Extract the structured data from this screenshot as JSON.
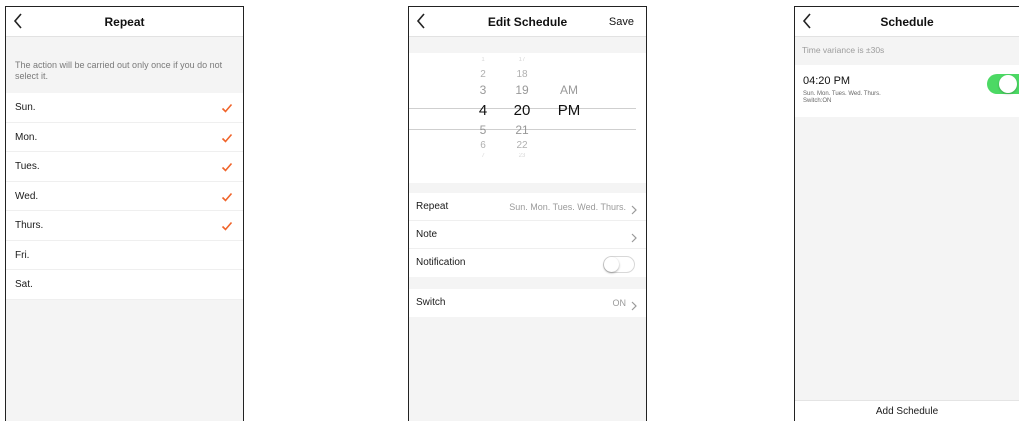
{
  "colors": {
    "accent_check": "#f0642a",
    "toggle_on": "#4cd964"
  },
  "repeat_screen": {
    "title": "Repeat",
    "hint": "The action will be carried out only once if you do not select it.",
    "days": [
      {
        "label": "Sun.",
        "checked": true
      },
      {
        "label": "Mon.",
        "checked": true
      },
      {
        "label": "Tues.",
        "checked": true
      },
      {
        "label": "Wed.",
        "checked": true
      },
      {
        "label": "Thurs.",
        "checked": true
      },
      {
        "label": "Fri.",
        "checked": false
      },
      {
        "label": "Sat.",
        "checked": false
      }
    ],
    "icons": {
      "back": "chevron-left-icon",
      "check": "checkmark-icon"
    }
  },
  "edit_screen": {
    "title": "Edit Schedule",
    "save_label": "Save",
    "picker": {
      "hours": [
        "1",
        "2",
        "3",
        "4",
        "5",
        "6",
        "7"
      ],
      "minutes": [
        "17",
        "18",
        "19",
        "20",
        "21",
        "22",
        "23"
      ],
      "periods": [
        "AM",
        "PM"
      ],
      "selected_hour": "4",
      "selected_minute": "20",
      "selected_period": "PM"
    },
    "repeat": {
      "label": "Repeat",
      "value": "Sun. Mon. Tues. Wed. Thurs."
    },
    "note": {
      "label": "Note",
      "value": ""
    },
    "notification": {
      "label": "Notification",
      "enabled": false
    },
    "switch": {
      "label": "Switch",
      "value": "ON"
    }
  },
  "schedule_screen": {
    "title": "Schedule",
    "variance": "Time variance is ±30s",
    "items": [
      {
        "time": "04:20 PM",
        "days": "Sun. Mon. Tues. Wed. Thurs.",
        "switch_text": "Switch:ON",
        "enabled": true
      }
    ],
    "add_label": "Add Schedule"
  }
}
